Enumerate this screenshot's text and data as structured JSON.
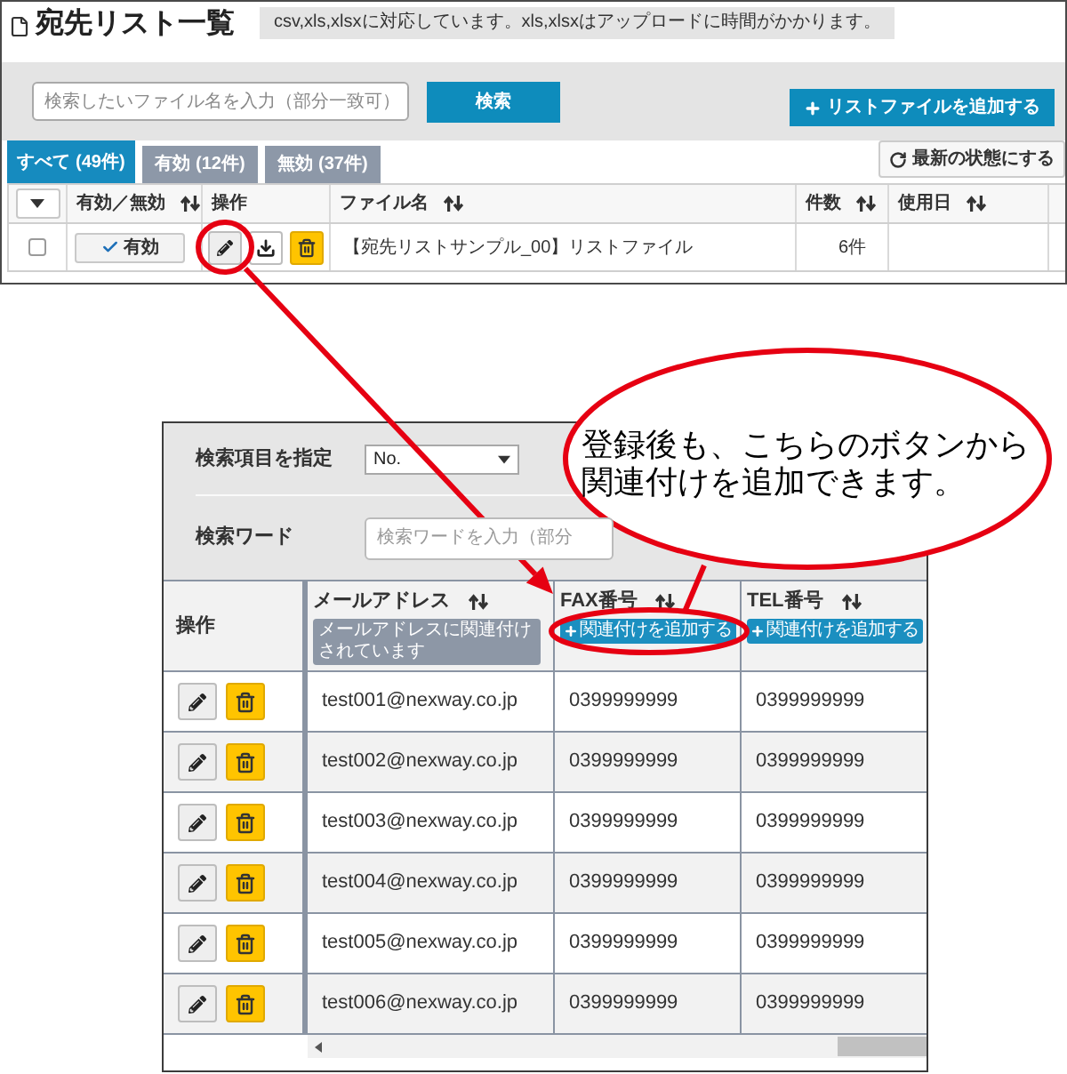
{
  "header": {
    "title": "宛先リスト一覧",
    "notice": "csv,xls,xlsxに対応しています。xls,xlsxはアップロードに時間がかかります。"
  },
  "search": {
    "placeholder": "検索したいファイル名を入力（部分一致可）",
    "button": "検索"
  },
  "add_button": "リストファイルを追加する",
  "tabs": [
    {
      "label": "すべて (49件)",
      "selected": true
    },
    {
      "label": "有効 (12件)",
      "selected": false
    },
    {
      "label": "無効 (37件)",
      "selected": false
    }
  ],
  "refresh_button": "最新の状態にする",
  "table": {
    "columns": [
      {
        "label": "有効／無効",
        "sortable": true
      },
      {
        "label": "操作",
        "sortable": false
      },
      {
        "label": "ファイル名",
        "sortable": true
      },
      {
        "label": "件数",
        "sortable": true
      },
      {
        "label": "使用日",
        "sortable": true
      }
    ],
    "rows": [
      {
        "checked": false,
        "status": "有効",
        "file_name": "【宛先リストサンプル_00】リストファイル",
        "count": "6件"
      }
    ]
  },
  "detail": {
    "field_label": "検索項目を指定",
    "field_value": "No.",
    "keyword_label": "検索ワード",
    "keyword_placeholder": "検索ワードを入力（部分",
    "action_column": {
      "label": "操作",
      "sortable": false
    },
    "columns": [
      {
        "label": "メールアドレス",
        "sortable": true,
        "tag": {
          "kind": "linked",
          "label": "メールアドレスに関連付けされています"
        }
      },
      {
        "label": "FAX番号",
        "sortable": true,
        "tag": {
          "kind": "add",
          "label": "関連付けを追加する"
        }
      },
      {
        "label": "TEL番号",
        "sortable": true,
        "tag": {
          "kind": "add",
          "label": "関連付けを追加する"
        }
      }
    ],
    "rows": [
      {
        "cells": [
          "test001@nexway.co.jp",
          "0399999999",
          "0399999999"
        ]
      },
      {
        "cells": [
          "test002@nexway.co.jp",
          "0399999999",
          "0399999999"
        ]
      },
      {
        "cells": [
          "test003@nexway.co.jp",
          "0399999999",
          "0399999999"
        ]
      },
      {
        "cells": [
          "test004@nexway.co.jp",
          "0399999999",
          "0399999999"
        ]
      },
      {
        "cells": [
          "test005@nexway.co.jp",
          "0399999999",
          "0399999999"
        ]
      },
      {
        "cells": [
          "test006@nexway.co.jp",
          "0399999999",
          "0399999999"
        ]
      }
    ]
  },
  "callout": {
    "text": "登録後も、こちらのボタンから関連付けを追加できます。"
  }
}
